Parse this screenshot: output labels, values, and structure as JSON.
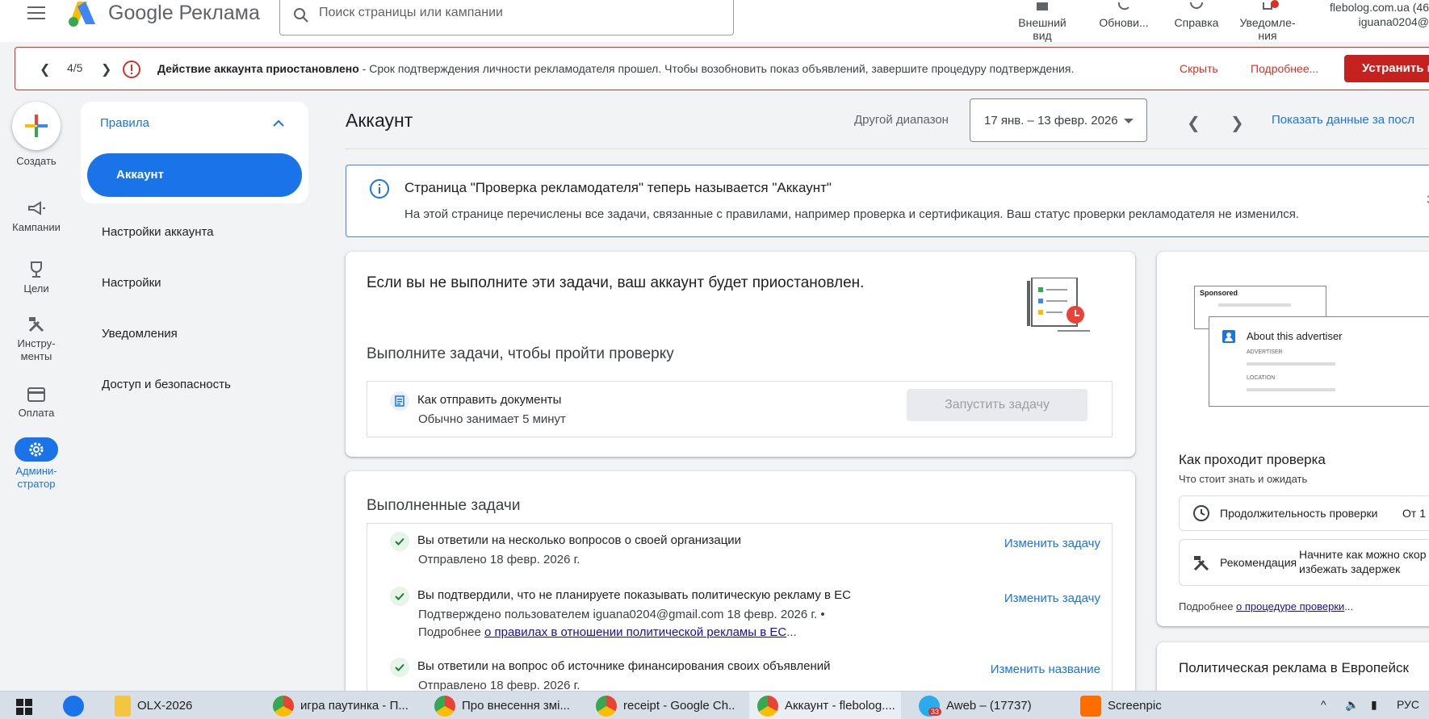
{
  "topbar": {
    "logo_text": "Google Реклама",
    "search_placeholder": "Поиск страницы или кампании",
    "actions": [
      {
        "label1": "Внешний",
        "label2": "вид"
      },
      {
        "label1": "Обнови...",
        "label2": ""
      },
      {
        "label1": "Справка",
        "label2": ""
      },
      {
        "label1": "Уведомле-",
        "label2": "ния"
      }
    ],
    "account_domain": "flebolog.com.ua (46",
    "account_email": "iguana0204@"
  },
  "alert": {
    "counter": "4/5",
    "title": "Действие аккаунта приостановлено",
    "message": " - Срок подтверждения личности рекламодателя прошел. Чтобы возобновить показ объявлений, завершите процедуру подтверждения.",
    "hide": "Скрыть",
    "more": "Подробнее...",
    "fix": "Устранить п"
  },
  "rail": {
    "create": "Создать",
    "campaigns": "Кампании",
    "goals": "Цели",
    "tools1": "Инстру-",
    "tools2": "менты",
    "billing": "Оплата",
    "admin1": "Админи-",
    "admin2": "стратор"
  },
  "subnav": {
    "section": "Правила",
    "active": "Аккаунт",
    "links": [
      "Настройки аккаунта",
      "Настройки",
      "Уведомления",
      "Доступ и безопасность"
    ]
  },
  "header": {
    "title": "Аккаунт",
    "range_label": "Другой диапазон",
    "range_value": "17 янв. – 13 февр. 2026",
    "show_data": "Показать данные за посл"
  },
  "info": {
    "title": "Страница \"Проверка рекламодателя\" теперь называется \"Аккаунт\"",
    "desc": "На этой странице перечислены все задачи, связанные с правилами, например проверка и сертификация. Ваш статус проверки рекламодателя не изменился.",
    "edge": "З"
  },
  "tasks": {
    "warning": "Если вы не выполните эти задачи, ваш аккаунт будет приостановлен.",
    "subtitle": "Выполните задачи, чтобы пройти проверку",
    "task_title": "Как отправить документы",
    "task_sub": "Обычно занимает 5 минут",
    "run": "Запустить задачу"
  },
  "done": {
    "title": "Выполненные задачи",
    "items": [
      {
        "title": "Вы ответили на несколько вопросов о своей организации",
        "sub": "Отправлено 18 февр. 2026 г.",
        "action": "Изменить задачу"
      },
      {
        "title": "Вы подтвердили, что не планируете показывать политическую рекламу в ЕС",
        "sub": "Подтверждено пользователем iguana0204@gmail.com 18 февр. 2026 г. •",
        "sub2_prefix": "Подробнее ",
        "sub2_link": "о правилах в отношении политической рекламы в ЕС",
        "sub2_suffix": "...",
        "action": "Изменить задачу"
      },
      {
        "title": "Вы ответили на вопрос об источнике финансирования своих объявлений",
        "sub": "Отправлено 18 февр. 2026 г.",
        "action": "Изменить название"
      }
    ]
  },
  "right": {
    "sponsored": "Sponsored",
    "about": "About this advertiser",
    "advertiser": "ADVERTISER",
    "location": "LOCATION",
    "heading": "Как проходит проверка",
    "subheading": "Что стоит знать и ожидать",
    "duration_label": "Продолжительность проверки",
    "duration_value": "От 1 д",
    "recommend_label": "Рекомендация",
    "recommend_value1": "Начните как можно скор",
    "recommend_value2": "избежать задержек",
    "more_prefix": "Подробнее ",
    "more_link": "о процедуре проверки",
    "more_suffix": "...",
    "political": "Политическая реклама в Европейск"
  },
  "taskbar": {
    "items": [
      "OLX-2026",
      "игра паутинка - П...",
      "Про внесення змі...",
      "receipt - Google Ch...",
      "Аккаунт - flebolog....",
      "Aweb – (17737)",
      "Screenpic"
    ],
    "lang": "РУС",
    "badge": "33"
  }
}
